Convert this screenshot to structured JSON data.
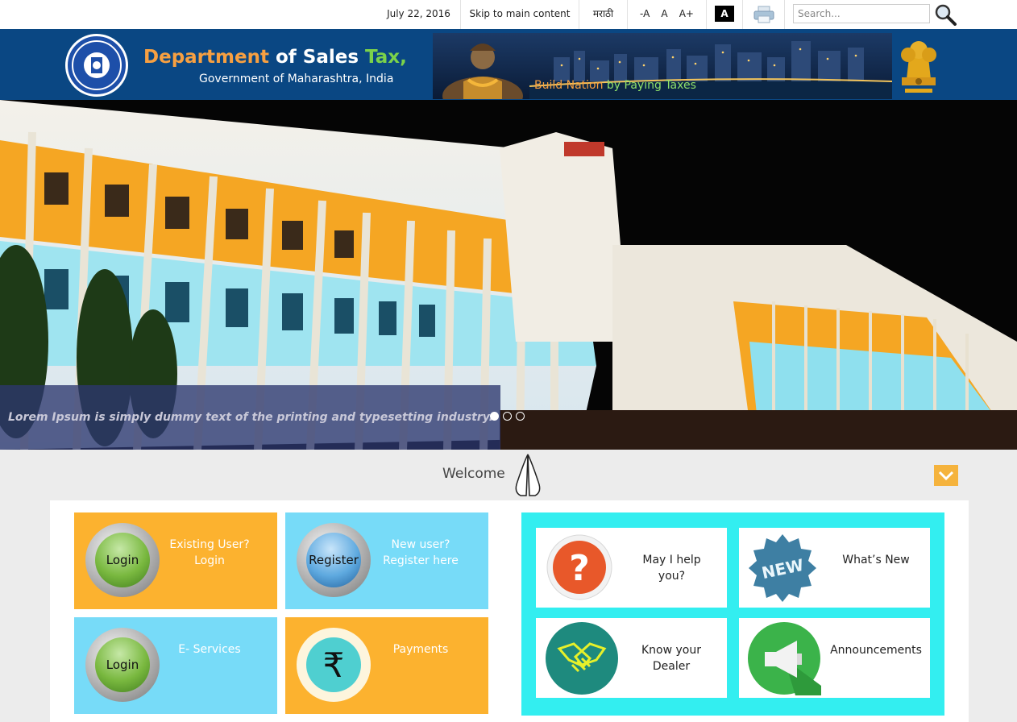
{
  "topbar": {
    "date": "July 22, 2016",
    "skip": "Skip to main content",
    "language": "मराठी",
    "font_decrease": "-A",
    "font_normal": "A",
    "font_increase": "A+",
    "contrast": "A",
    "search_placeholder": "Search...",
    "print_icon": "printer-icon",
    "search_icon": "magnifier-icon"
  },
  "header": {
    "title_part1": "Department",
    "title_part2": " of Sales ",
    "title_part3": "Tax,",
    "subtitle": "Government of Maharashtra, India",
    "banner_tag_part1": "Build Nation ",
    "banner_tag_part2": "by Paying Taxes",
    "colors": {
      "header_bg": "#0a4783",
      "accent_orange": "#f7a041",
      "accent_green": "#7bd24a"
    }
  },
  "hero": {
    "caption": "Lorem Ipsum is simply dummy text of the printing and typesetting industry.",
    "slides": 3,
    "active_slide": 1
  },
  "welcome": {
    "text": "Welcome",
    "icon": "namaste-icon",
    "collapse_icon": "chevron-down-icon"
  },
  "tiles": [
    {
      "orb_text": "Login",
      "label_line1": "Existing User?",
      "label_line2": "Login",
      "color": "#fcb22f"
    },
    {
      "orb_text": "Register",
      "label_line1": "New user?",
      "label_line2": "Register here",
      "color": "#77dbf8"
    },
    {
      "orb_text": "Login",
      "label_line1": "E- Services",
      "label_line2": "",
      "color": "#77dbf8"
    },
    {
      "orb_text": "₹",
      "label_line1": "Payments",
      "label_line2": "",
      "color": "#fcb22f"
    }
  ],
  "cards": [
    {
      "line1": "May I help",
      "line2": "you?",
      "icon": "question-icon"
    },
    {
      "line1": "What’s New",
      "line2": "",
      "icon": "new-badge-icon"
    },
    {
      "line1": "Know your",
      "line2": "Dealer",
      "icon": "handshake-icon"
    },
    {
      "line1": "Announcements",
      "line2": "",
      "icon": "megaphone-icon"
    }
  ]
}
